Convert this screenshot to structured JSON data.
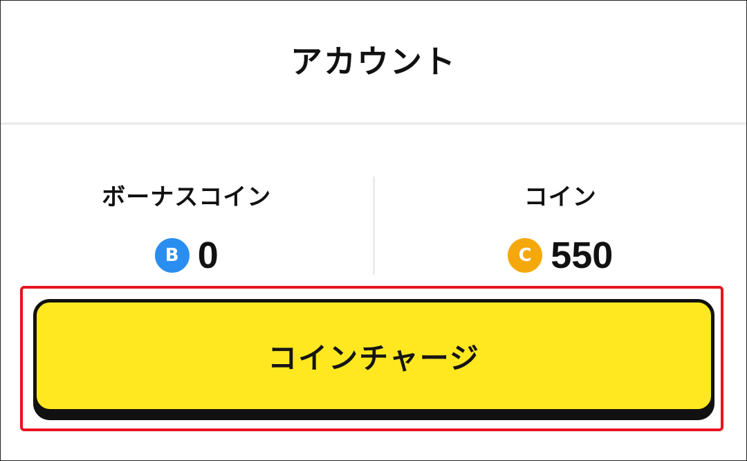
{
  "header": {
    "title": "アカウント"
  },
  "balances": {
    "bonus": {
      "label": "ボーナスコイン",
      "badge": "B",
      "value": "0",
      "color": "#2a8ef0"
    },
    "coin": {
      "label": "コイン",
      "badge": "C",
      "value": "550",
      "color": "#f5a80a"
    }
  },
  "charge_button": {
    "label": "コインチャージ",
    "color": "#ffe820"
  },
  "highlight_color": "#e8141f"
}
